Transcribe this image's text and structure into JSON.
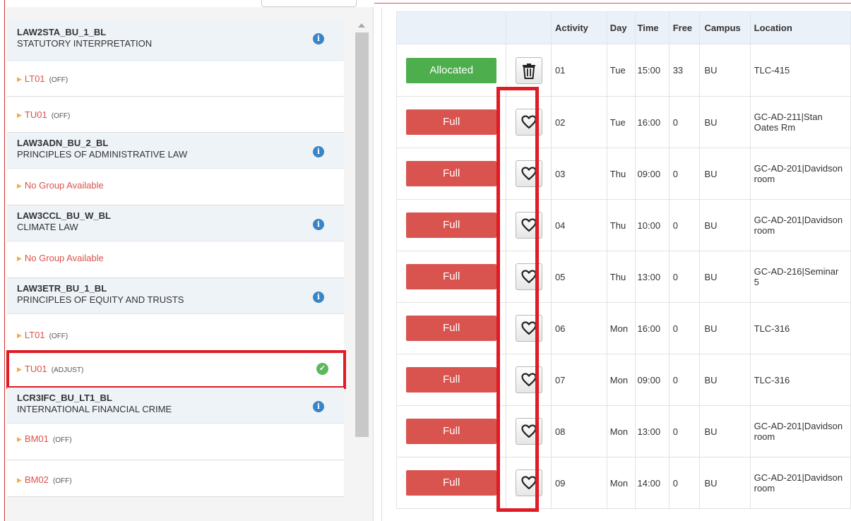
{
  "courses": [
    {
      "code": "LAW2STA_BU_1_BL",
      "name": "STATUTORY INTERPRETATION",
      "info_icon": "info-icon",
      "groups": [
        {
          "code": "LT01",
          "status": "(OFF)"
        },
        {
          "code": "TU01",
          "status": "(OFF)"
        }
      ]
    },
    {
      "code": "LAW3ADN_BU_2_BL",
      "name": "PRINCIPLES OF ADMINISTRATIVE LAW",
      "info_icon": "info-icon",
      "no_group": "No Group Available"
    },
    {
      "code": "LAW3CCL_BU_W_BL",
      "name": "CLIMATE LAW",
      "info_icon": "info-icon",
      "no_group": "No Group Available"
    },
    {
      "code": "LAW3ETR_BU_1_BL",
      "name": "PRINCIPLES OF EQUITY AND TRUSTS",
      "info_icon": "info-icon",
      "groups": [
        {
          "code": "LT01",
          "status": "(OFF)"
        },
        {
          "code": "TU01",
          "status": "(ADJUST)",
          "selected": true,
          "icon": "check-circle-icon"
        }
      ]
    },
    {
      "code": "LCR3IFC_BU_LT1_BL",
      "name": "INTERNATIONAL FINANCIAL CRIME",
      "info_icon": "info-icon",
      "groups": [
        {
          "code": "BM01",
          "status": "(OFF)"
        },
        {
          "code": "BM02",
          "status": "(OFF)"
        }
      ]
    }
  ],
  "table": {
    "headers": {
      "activity": "Activity",
      "day": "Day",
      "time": "Time",
      "free": "Free",
      "campus": "Campus",
      "location": "Location"
    },
    "rows": [
      {
        "status": "Allocated",
        "action_icon": "trash-icon",
        "activity": "01",
        "day": "Tue",
        "time": "15:00",
        "free": "33",
        "campus": "BU",
        "location": "TLC-415"
      },
      {
        "status": "Full",
        "action_icon": "heart-icon",
        "activity": "02",
        "day": "Tue",
        "time": "16:00",
        "free": "0",
        "campus": "BU",
        "location": "GC-AD-211|Stan Oates Rm"
      },
      {
        "status": "Full",
        "action_icon": "heart-icon",
        "activity": "03",
        "day": "Thu",
        "time": "09:00",
        "free": "0",
        "campus": "BU",
        "location": "GC-AD-201|Davidson room"
      },
      {
        "status": "Full",
        "action_icon": "heart-icon",
        "activity": "04",
        "day": "Thu",
        "time": "10:00",
        "free": "0",
        "campus": "BU",
        "location": "GC-AD-201|Davidson room"
      },
      {
        "status": "Full",
        "action_icon": "heart-icon",
        "activity": "05",
        "day": "Thu",
        "time": "13:00",
        "free": "0",
        "campus": "BU",
        "location": "GC-AD-216|Seminar 5"
      },
      {
        "status": "Full",
        "action_icon": "heart-icon",
        "activity": "06",
        "day": "Mon",
        "time": "16:00",
        "free": "0",
        "campus": "BU",
        "location": "TLC-316"
      },
      {
        "status": "Full",
        "action_icon": "heart-icon",
        "activity": "07",
        "day": "Mon",
        "time": "09:00",
        "free": "0",
        "campus": "BU",
        "location": "TLC-316"
      },
      {
        "status": "Full",
        "action_icon": "heart-icon",
        "activity": "08",
        "day": "Mon",
        "time": "13:00",
        "free": "0",
        "campus": "BU",
        "location": "GC-AD-201|Davidson room"
      },
      {
        "status": "Full",
        "action_icon": "heart-icon",
        "activity": "09",
        "day": "Mon",
        "time": "14:00",
        "free": "0",
        "campus": "BU",
        "location": "GC-AD-201|Davidson room"
      }
    ]
  },
  "colors": {
    "allocated": "#4cae4c",
    "full": "#d9534f",
    "highlight": "#e01b24",
    "info": "#3b84c6",
    "check": "#5cb85c"
  }
}
